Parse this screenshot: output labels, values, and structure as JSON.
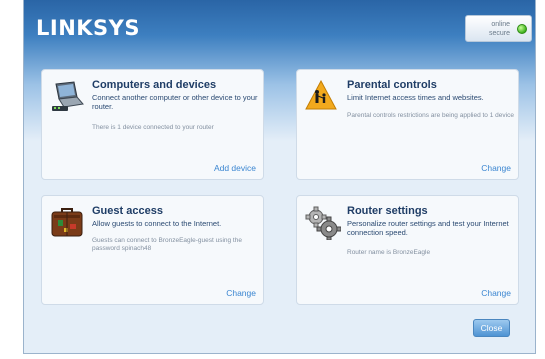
{
  "header": {
    "logo": "LINKSYS",
    "status_line1": "online",
    "status_line2": "secure",
    "status_color": "#3fb21e"
  },
  "panels": {
    "computers": {
      "title": "Computers and devices",
      "subtitle": "Connect another computer or other device to your router.",
      "note": "There is 1 device connected to your router",
      "action": "Add device",
      "icon": "laptop-router-icon"
    },
    "parental": {
      "title": "Parental controls",
      "subtitle": "Limit Internet access times and websites.",
      "note": "Parental controls restrictions are being applied to 1 device",
      "action": "Change",
      "icon": "parental-sign-icon"
    },
    "guest": {
      "title": "Guest access",
      "subtitle": "Allow guests to connect to the Internet.",
      "note": "Guests can connect to BronzeEagle-guest using the password spinach48",
      "action": "Change",
      "icon": "suitcase-icon"
    },
    "router": {
      "title": "Router settings",
      "subtitle": "Personalize router settings and test your Internet connection speed.",
      "note": "Router name is BronzeEagle",
      "action": "Change",
      "icon": "gears-icon"
    }
  },
  "footer": {
    "close_label": "Close"
  },
  "colors": {
    "accent": "#3b86d1",
    "title": "#1f3d66",
    "header_blue": "#2a65a6"
  }
}
